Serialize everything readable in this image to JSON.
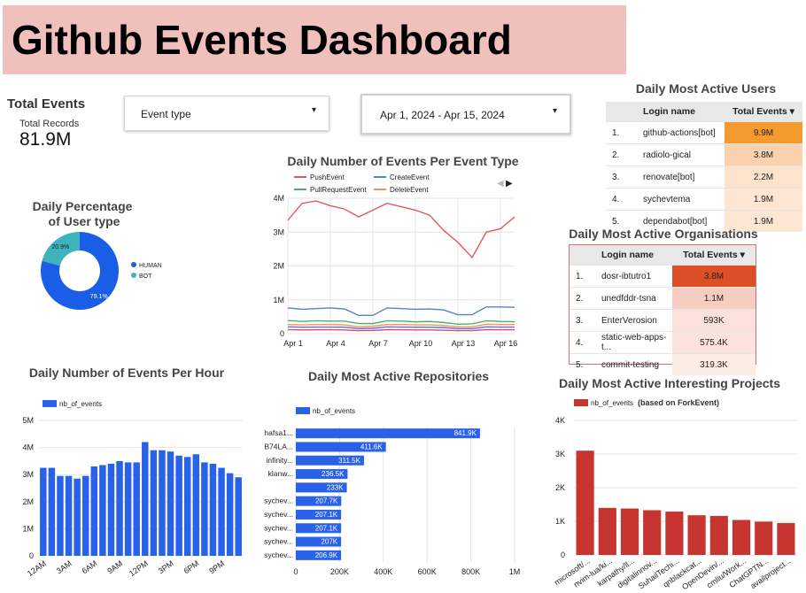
{
  "header": {
    "title": "Github Events Dashboard"
  },
  "total_events": {
    "title": "Total Events",
    "label": "Total Records",
    "value": "81.9M"
  },
  "filters": {
    "event_type": {
      "label": "Event type"
    },
    "date_range": {
      "label": "Apr 1, 2024 - Apr 15, 2024"
    }
  },
  "users_table": {
    "title": "Daily Most Active Users",
    "col_login": "Login name",
    "col_total": "Total Events",
    "rows": [
      {
        "rank": "1.",
        "login": "github-actions[bot]",
        "total": "9.9M",
        "color": "#f49a2e"
      },
      {
        "rank": "2.",
        "login": "radiolo-gical",
        "total": "3.8M",
        "color": "#fbd2ad"
      },
      {
        "rank": "3.",
        "login": "renovate[bot]",
        "total": "2.2M",
        "color": "#fde3cc"
      },
      {
        "rank": "4.",
        "login": "sychevtema",
        "total": "1.9M",
        "color": "#fde7d3"
      },
      {
        "rank": "5.",
        "login": "dependabot[bot]",
        "total": "1.9M",
        "color": "#fde7d3"
      }
    ]
  },
  "orgs_table": {
    "title": "Daily Most Active Organisations",
    "col_login": "Login name",
    "col_total": "Total Events",
    "rows": [
      {
        "rank": "1.",
        "login": "dosr-ibtutro1",
        "total": "3.8M",
        "color": "#dd4f26"
      },
      {
        "rank": "2.",
        "login": "unedfddr-tsna",
        "total": "1.1M",
        "color": "#f7cdc2"
      },
      {
        "rank": "3.",
        "login": "EnterVerosion",
        "total": "593K",
        "color": "#fbe1d9"
      },
      {
        "rank": "4.",
        "login": "static-web-apps-t...",
        "total": "575.4K",
        "color": "#fbe2da"
      },
      {
        "rank": "5.",
        "login": "commit-testing",
        "total": "319.3K",
        "color": "#fcece6"
      }
    ]
  },
  "charts": [
    {
      "type": "pie",
      "title": "Daily Percentage of User type",
      "slices": [
        {
          "name": "HUMAN",
          "value": 79.1,
          "label": "79.1%",
          "color": "#1a5ee8"
        },
        {
          "name": "BOT",
          "value": 20.9,
          "label": "20.9%",
          "color": "#3fb3bd"
        }
      ]
    },
    {
      "type": "line",
      "title": "Daily Number of Events Per Event Type",
      "x_ticks": [
        "Apr 1",
        "Apr 4",
        "Apr 7",
        "Apr 10",
        "Apr 13",
        "Apr 16"
      ],
      "x_tick_index": [
        0,
        3,
        6,
        9,
        12,
        15
      ],
      "y_ticks": [
        "0",
        "1M",
        "2M",
        "3M",
        "4M"
      ],
      "ylim": [
        0,
        4000000
      ],
      "series": [
        {
          "name": "PushEvent",
          "color": "#e05a5a",
          "values": [
            3350000,
            3850000,
            3920000,
            3780000,
            3680000,
            3450000,
            3650000,
            3850000,
            3750000,
            3650000,
            3500000,
            3050000,
            2700000,
            2250000,
            3000000,
            3100000,
            3450000
          ]
        },
        {
          "name": "CreateEvent",
          "color": "#4f86c6",
          "values": [
            760000,
            720000,
            740000,
            760000,
            730000,
            540000,
            540000,
            760000,
            740000,
            720000,
            730000,
            700000,
            560000,
            560000,
            790000,
            790000,
            780000
          ]
        },
        {
          "name": "PullRequestEvent",
          "color": "#49b06c",
          "values": [
            390000,
            360000,
            380000,
            370000,
            370000,
            300000,
            300000,
            380000,
            370000,
            350000,
            360000,
            330000,
            280000,
            290000,
            380000,
            360000,
            350000
          ]
        },
        {
          "name": "DeleteEvent",
          "color": "#f0955a",
          "values": [
            270000,
            260000,
            270000,
            270000,
            260000,
            200000,
            220000,
            270000,
            270000,
            260000,
            260000,
            240000,
            200000,
            200000,
            280000,
            270000,
            270000
          ]
        }
      ],
      "extra_series": [
        {
          "color": "#6a6cc6",
          "values": [
            200000,
            190000,
            195000,
            195000,
            190000,
            150000,
            160000,
            200000,
            195000,
            190000,
            190000,
            180000,
            150000,
            150000,
            200000,
            195000,
            195000
          ]
        },
        {
          "color": "#c94f7c",
          "values": [
            120000,
            110000,
            115000,
            115000,
            110000,
            90000,
            95000,
            120000,
            115000,
            110000,
            110000,
            100000,
            90000,
            90000,
            120000,
            115000,
            115000
          ]
        }
      ]
    },
    {
      "type": "bar",
      "title": "Daily Number of Events Per Hour",
      "legend": "nb_of_events",
      "color": "#2962e8",
      "x_ticks": [
        "12AM",
        "3AM",
        "6AM",
        "9AM",
        "12PM",
        "3PM",
        "6PM",
        "9PM"
      ],
      "x_tick_index": [
        0,
        3,
        6,
        9,
        12,
        15,
        18,
        21
      ],
      "y_ticks": [
        "0",
        "1M",
        "2M",
        "3M",
        "4M",
        "5M"
      ],
      "ylim": [
        0,
        5000000
      ],
      "values": [
        3250000,
        3250000,
        2950000,
        2950000,
        2850000,
        2950000,
        3300000,
        3350000,
        3400000,
        3500000,
        3450000,
        3450000,
        4200000,
        3900000,
        3900000,
        3850000,
        3700000,
        3650000,
        3750000,
        3450000,
        3400000,
        3250000,
        3050000,
        2900000
      ]
    },
    {
      "type": "bar",
      "orientation": "horizontal",
      "title": "Daily Most Active Repositories",
      "legend": "nb_of_events",
      "color": "#2962e8",
      "categories": [
        "hafsa1...",
        "B74LA...",
        "infinity...",
        "klanw...",
        "",
        "sychev...",
        "sychev...",
        "sychev...",
        "sychev...",
        "sychev..."
      ],
      "values": [
        841900,
        411600,
        311500,
        236500,
        233000,
        207700,
        207100,
        207100,
        207000,
        206900
      ],
      "labels": [
        "841.9K",
        "411.6K",
        "311.5K",
        "236.5K",
        "233K",
        "207.7K",
        "207.1K",
        "207.1K",
        "207K",
        "206.9K"
      ],
      "x_ticks": [
        "0",
        "200K",
        "400K",
        "600K",
        "800K",
        "1M"
      ],
      "xlim": [
        0,
        1000000
      ]
    },
    {
      "type": "bar",
      "title": "Daily Most Active Interesting Projects",
      "legend": "nb_of_events",
      "legend_note": "(based on ForkEvent)",
      "color": "#c6352f",
      "categories": [
        "microsoft/...",
        "nvim-lua/ki...",
        "karpathy/ll...",
        "digitalinnov...",
        "SuhailTechi...",
        "qnblackcat...",
        "OpenDevin/...",
        "cmliu/Work...",
        "ChatGPTN...",
        "availproject..."
      ],
      "values": [
        3100,
        1400,
        1380,
        1330,
        1290,
        1180,
        1160,
        1040,
        990,
        950
      ],
      "y_ticks": [
        "0",
        "1K",
        "2K",
        "3K",
        "4K"
      ],
      "ylim": [
        0,
        4000
      ]
    }
  ]
}
